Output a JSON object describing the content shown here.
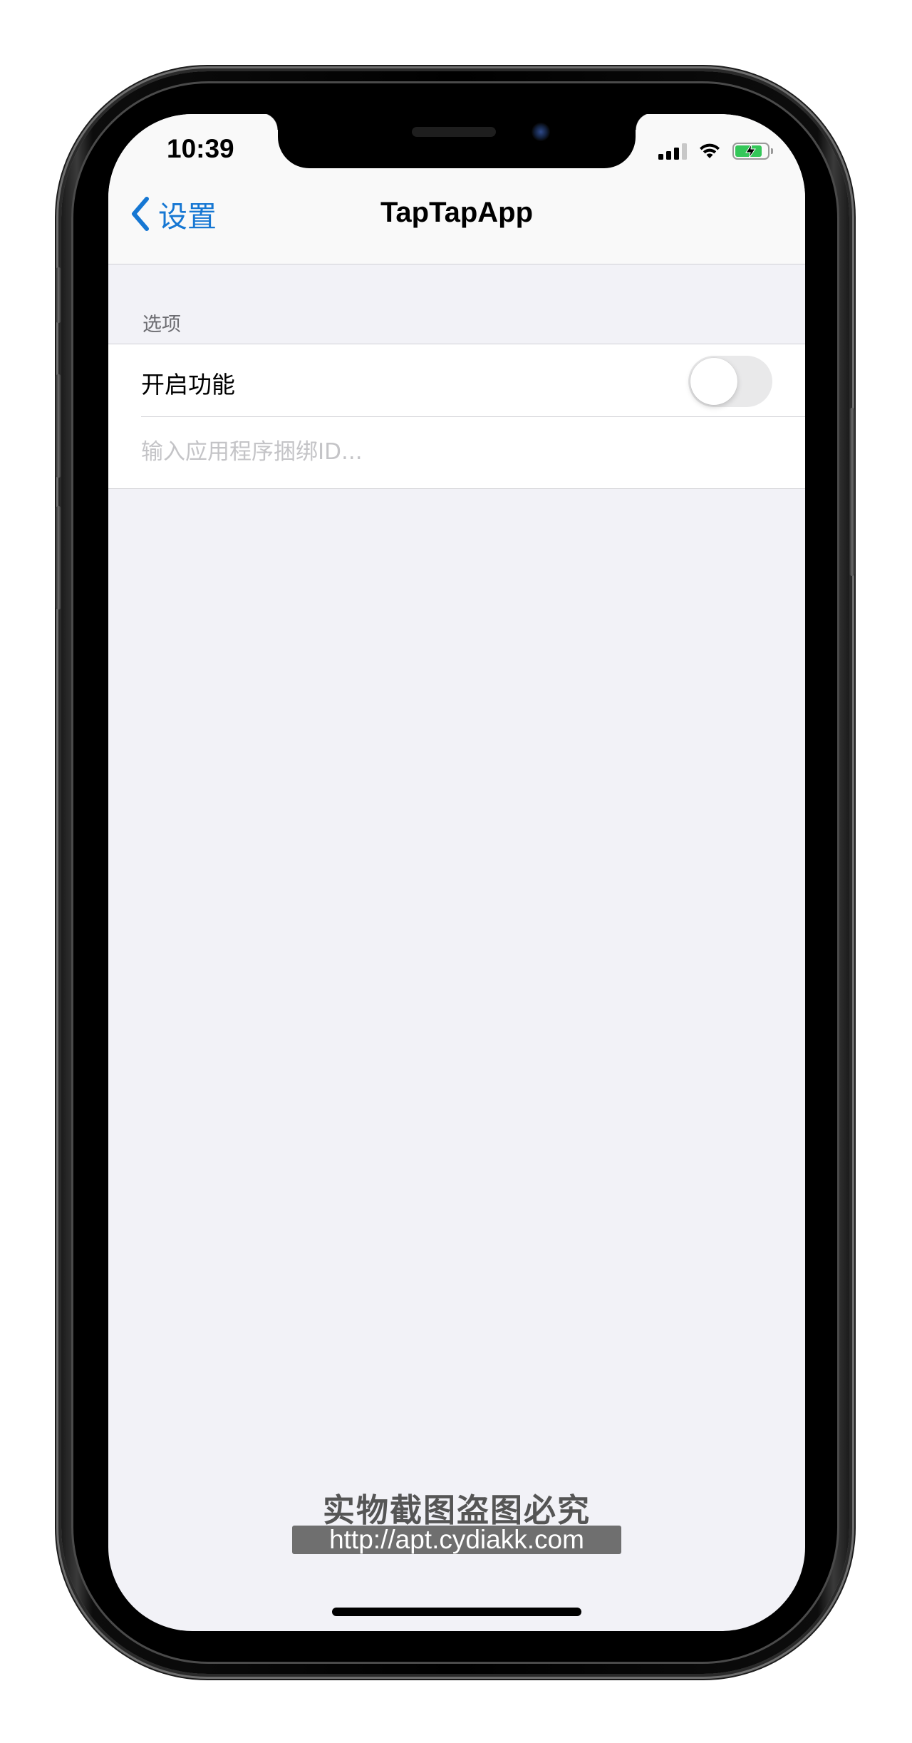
{
  "status_bar": {
    "time": "10:39",
    "icons": [
      "cellular-signal-icon",
      "wifi-icon",
      "battery-charging-icon"
    ],
    "battery_level": 0.85,
    "battery_color": "#34c759"
  },
  "nav": {
    "back_label": "设置",
    "title": "TapTapApp",
    "accent_color": "#1677d3"
  },
  "options": {
    "header": "选项",
    "enable_label": "开启功能",
    "enable_on": false,
    "bundle_input": {
      "value": "",
      "placeholder": "输入应用程序捆绑ID..."
    }
  },
  "watermark": {
    "text": "实物截图盗图必究",
    "url": "http://apt.cydiakk.com"
  }
}
